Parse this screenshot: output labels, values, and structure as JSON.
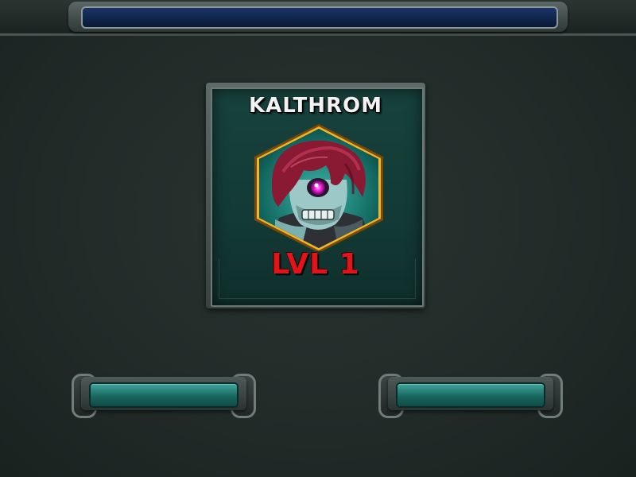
{
  "hero": {
    "name": "KALTHROM",
    "level": "LVL 1"
  },
  "colors": {
    "background": "#1f2926",
    "card": "#17423d",
    "hex_border": "#e0a21e",
    "level_text": "#e3131a",
    "button_face": "#19675f",
    "top_bar": "#10244b"
  },
  "icons": {
    "portrait": "cyclops-hero-portrait"
  },
  "buttons": {
    "left_label": "",
    "right_label": ""
  }
}
